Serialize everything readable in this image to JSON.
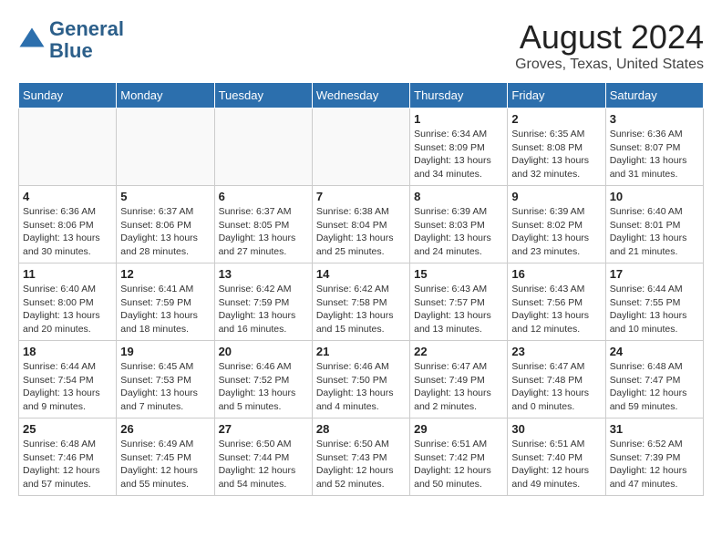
{
  "header": {
    "logo_line1": "General",
    "logo_line2": "Blue",
    "month_year": "August 2024",
    "location": "Groves, Texas, United States"
  },
  "weekdays": [
    "Sunday",
    "Monday",
    "Tuesday",
    "Wednesday",
    "Thursday",
    "Friday",
    "Saturday"
  ],
  "weeks": [
    [
      {
        "day": "",
        "info": ""
      },
      {
        "day": "",
        "info": ""
      },
      {
        "day": "",
        "info": ""
      },
      {
        "day": "",
        "info": ""
      },
      {
        "day": "1",
        "info": "Sunrise: 6:34 AM\nSunset: 8:09 PM\nDaylight: 13 hours\nand 34 minutes."
      },
      {
        "day": "2",
        "info": "Sunrise: 6:35 AM\nSunset: 8:08 PM\nDaylight: 13 hours\nand 32 minutes."
      },
      {
        "day": "3",
        "info": "Sunrise: 6:36 AM\nSunset: 8:07 PM\nDaylight: 13 hours\nand 31 minutes."
      }
    ],
    [
      {
        "day": "4",
        "info": "Sunrise: 6:36 AM\nSunset: 8:06 PM\nDaylight: 13 hours\nand 30 minutes."
      },
      {
        "day": "5",
        "info": "Sunrise: 6:37 AM\nSunset: 8:06 PM\nDaylight: 13 hours\nand 28 minutes."
      },
      {
        "day": "6",
        "info": "Sunrise: 6:37 AM\nSunset: 8:05 PM\nDaylight: 13 hours\nand 27 minutes."
      },
      {
        "day": "7",
        "info": "Sunrise: 6:38 AM\nSunset: 8:04 PM\nDaylight: 13 hours\nand 25 minutes."
      },
      {
        "day": "8",
        "info": "Sunrise: 6:39 AM\nSunset: 8:03 PM\nDaylight: 13 hours\nand 24 minutes."
      },
      {
        "day": "9",
        "info": "Sunrise: 6:39 AM\nSunset: 8:02 PM\nDaylight: 13 hours\nand 23 minutes."
      },
      {
        "day": "10",
        "info": "Sunrise: 6:40 AM\nSunset: 8:01 PM\nDaylight: 13 hours\nand 21 minutes."
      }
    ],
    [
      {
        "day": "11",
        "info": "Sunrise: 6:40 AM\nSunset: 8:00 PM\nDaylight: 13 hours\nand 20 minutes."
      },
      {
        "day": "12",
        "info": "Sunrise: 6:41 AM\nSunset: 7:59 PM\nDaylight: 13 hours\nand 18 minutes."
      },
      {
        "day": "13",
        "info": "Sunrise: 6:42 AM\nSunset: 7:59 PM\nDaylight: 13 hours\nand 16 minutes."
      },
      {
        "day": "14",
        "info": "Sunrise: 6:42 AM\nSunset: 7:58 PM\nDaylight: 13 hours\nand 15 minutes."
      },
      {
        "day": "15",
        "info": "Sunrise: 6:43 AM\nSunset: 7:57 PM\nDaylight: 13 hours\nand 13 minutes."
      },
      {
        "day": "16",
        "info": "Sunrise: 6:43 AM\nSunset: 7:56 PM\nDaylight: 13 hours\nand 12 minutes."
      },
      {
        "day": "17",
        "info": "Sunrise: 6:44 AM\nSunset: 7:55 PM\nDaylight: 13 hours\nand 10 minutes."
      }
    ],
    [
      {
        "day": "18",
        "info": "Sunrise: 6:44 AM\nSunset: 7:54 PM\nDaylight: 13 hours\nand 9 minutes."
      },
      {
        "day": "19",
        "info": "Sunrise: 6:45 AM\nSunset: 7:53 PM\nDaylight: 13 hours\nand 7 minutes."
      },
      {
        "day": "20",
        "info": "Sunrise: 6:46 AM\nSunset: 7:52 PM\nDaylight: 13 hours\nand 5 minutes."
      },
      {
        "day": "21",
        "info": "Sunrise: 6:46 AM\nSunset: 7:50 PM\nDaylight: 13 hours\nand 4 minutes."
      },
      {
        "day": "22",
        "info": "Sunrise: 6:47 AM\nSunset: 7:49 PM\nDaylight: 13 hours\nand 2 minutes."
      },
      {
        "day": "23",
        "info": "Sunrise: 6:47 AM\nSunset: 7:48 PM\nDaylight: 13 hours\nand 0 minutes."
      },
      {
        "day": "24",
        "info": "Sunrise: 6:48 AM\nSunset: 7:47 PM\nDaylight: 12 hours\nand 59 minutes."
      }
    ],
    [
      {
        "day": "25",
        "info": "Sunrise: 6:48 AM\nSunset: 7:46 PM\nDaylight: 12 hours\nand 57 minutes."
      },
      {
        "day": "26",
        "info": "Sunrise: 6:49 AM\nSunset: 7:45 PM\nDaylight: 12 hours\nand 55 minutes."
      },
      {
        "day": "27",
        "info": "Sunrise: 6:50 AM\nSunset: 7:44 PM\nDaylight: 12 hours\nand 54 minutes."
      },
      {
        "day": "28",
        "info": "Sunrise: 6:50 AM\nSunset: 7:43 PM\nDaylight: 12 hours\nand 52 minutes."
      },
      {
        "day": "29",
        "info": "Sunrise: 6:51 AM\nSunset: 7:42 PM\nDaylight: 12 hours\nand 50 minutes."
      },
      {
        "day": "30",
        "info": "Sunrise: 6:51 AM\nSunset: 7:40 PM\nDaylight: 12 hours\nand 49 minutes."
      },
      {
        "day": "31",
        "info": "Sunrise: 6:52 AM\nSunset: 7:39 PM\nDaylight: 12 hours\nand 47 minutes."
      }
    ]
  ]
}
